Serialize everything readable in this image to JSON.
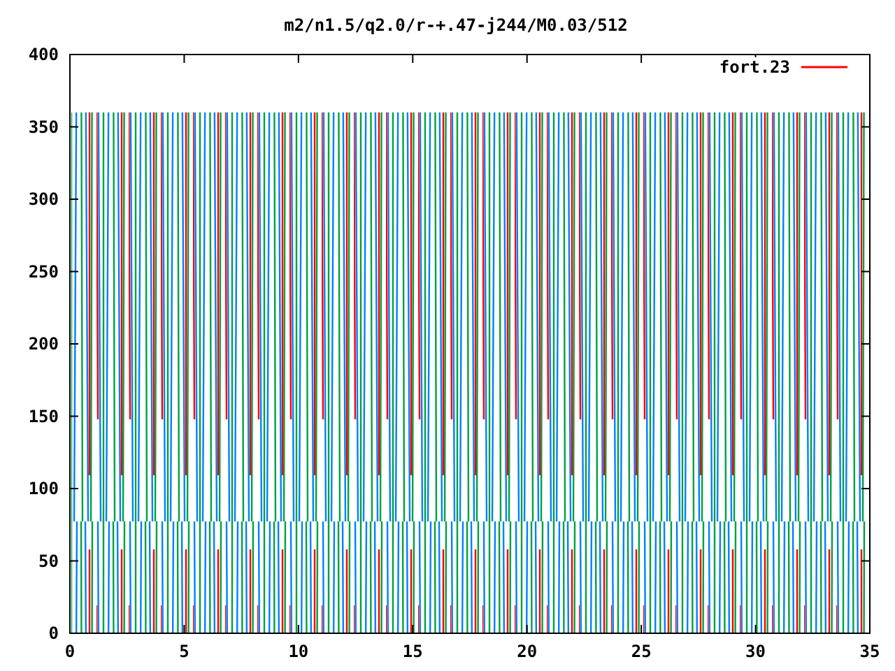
{
  "title": "m2/n1.5/q2.0/r-+.47-j244/M0.03/512",
  "legend": {
    "label": "fort.23"
  },
  "x_axis": {
    "ticks": [
      "0",
      "5",
      "10",
      "15",
      "20",
      "25",
      "30",
      "35"
    ]
  },
  "y_axis": {
    "ticks": [
      "400",
      "350",
      "300",
      "250",
      "200",
      "150",
      "100",
      "50",
      "0"
    ]
  }
}
